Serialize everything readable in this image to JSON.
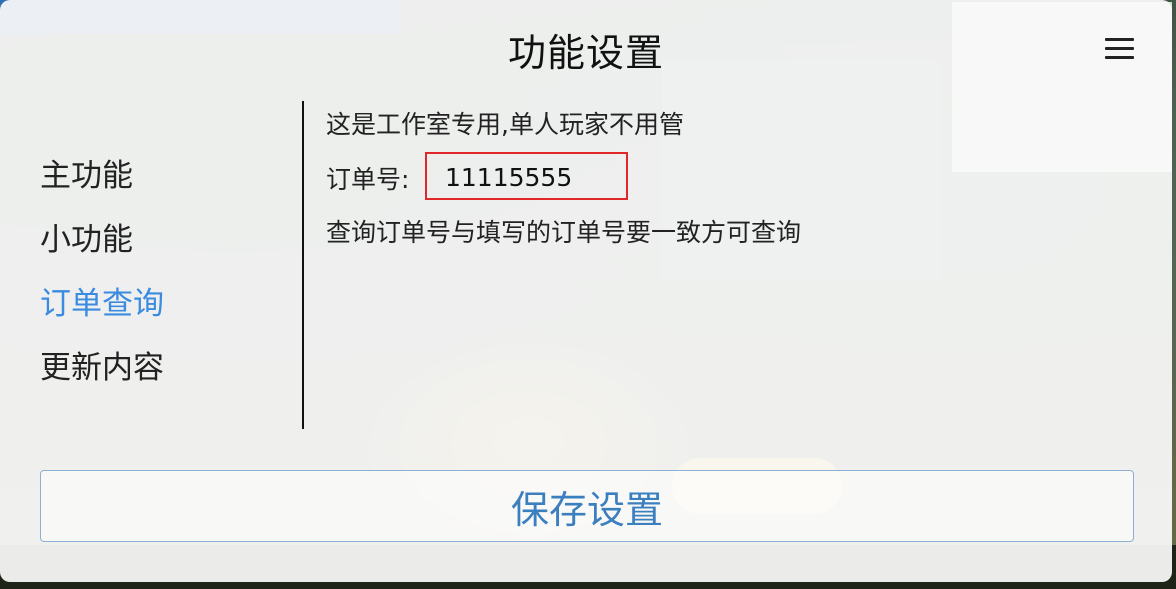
{
  "dialog": {
    "title": "功能设置",
    "menu_icon": "hamburger-menu-icon"
  },
  "sidebar": {
    "items": [
      {
        "label": "主功能",
        "active": false
      },
      {
        "label": "小功能",
        "active": false
      },
      {
        "label": "订单查询",
        "active": true
      },
      {
        "label": "更新内容",
        "active": false
      }
    ]
  },
  "order_query": {
    "notice": "这是工作室专用,单人玩家不用管",
    "order_label": "订单号:",
    "order_value": "11115555",
    "hint": "查询订单号与填写的订单号要一致方可查询"
  },
  "footer": {
    "save_label": "保存设置"
  },
  "colors": {
    "active_item": "#3b8be0",
    "save_text": "#3c7fbf",
    "highlight_border": "#e2272a"
  }
}
